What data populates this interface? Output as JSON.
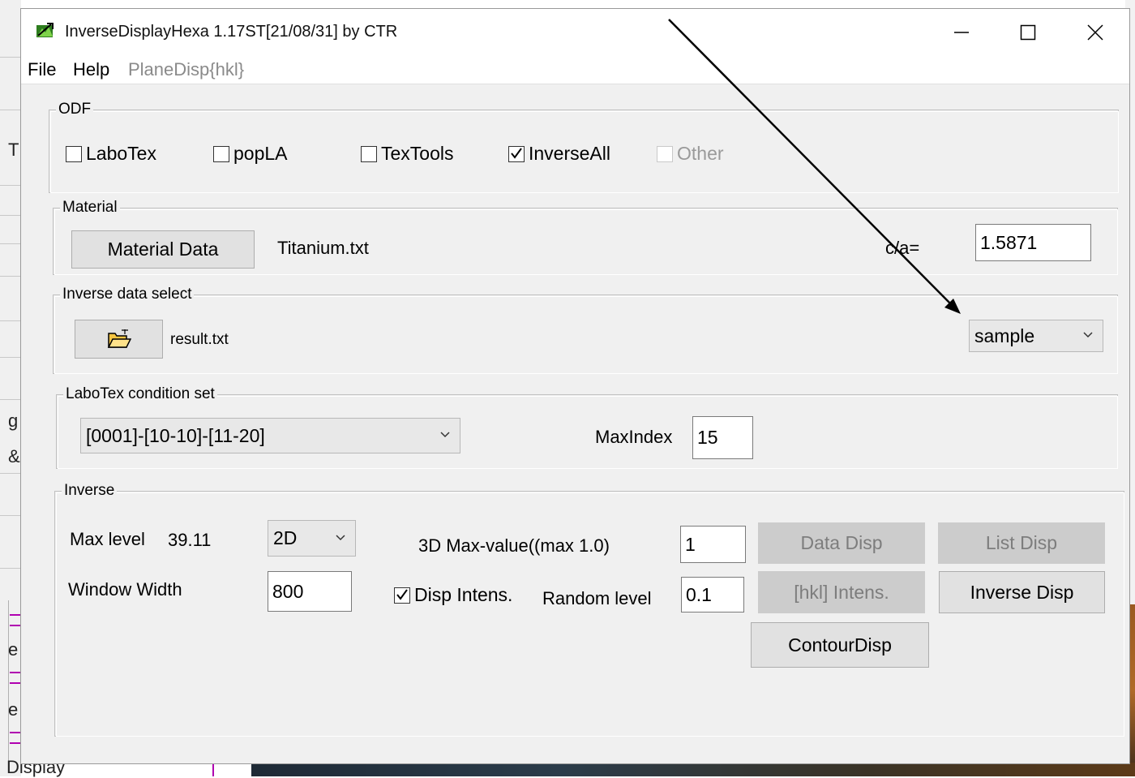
{
  "window": {
    "title": "InverseDisplayHexa 1.17ST[21/08/31] by CTR"
  },
  "menu": {
    "file": "File",
    "help": "Help",
    "plane_disp": "PlaneDisp{hkl}"
  },
  "odf": {
    "legend": "ODF",
    "options": [
      {
        "label": "LaboTex",
        "checked": false,
        "enabled": true
      },
      {
        "label": "popLA",
        "checked": false,
        "enabled": true
      },
      {
        "label": "TexTools",
        "checked": false,
        "enabled": true
      },
      {
        "label": "InverseAll",
        "checked": true,
        "enabled": true
      },
      {
        "label": "Other",
        "checked": false,
        "enabled": false
      }
    ]
  },
  "material": {
    "legend": "Material",
    "button_label": "Material Data",
    "file_name": "Titanium.txt",
    "ca_label": "c/a=",
    "ca_value": "1.5871"
  },
  "inverse_select": {
    "legend": "Inverse data select",
    "file_name": "result.txt",
    "mode_selected": "sample"
  },
  "labotex": {
    "legend": "LaboTex condition set",
    "condition_selected": "[0001]-[10-10]-[11-20]",
    "maxindex_label": "MaxIndex",
    "maxindex_value": "15"
  },
  "inverse": {
    "legend": "Inverse",
    "max_level_label": "Max level",
    "max_level_value": "39.11",
    "dim_selected": "2D",
    "window_width_label": "Window Width",
    "window_width_value": "800",
    "max_value_label": "3D Max-value((max 1.0)",
    "max_value_value": "1",
    "disp_intens_label": "Disp Intens.",
    "disp_intens_checked": true,
    "random_level_label": "Random level",
    "random_level_value": "0.1",
    "data_disp_label": "Data Disp",
    "list_disp_label": "List Disp",
    "hkl_intens_label": "[hkl] Intens.",
    "inverse_disp_label": "Inverse Disp",
    "contour_disp_label": "ContourDisp"
  },
  "background": {
    "left_glyphs": [
      "T",
      "g",
      "&",
      "e",
      "e"
    ],
    "bottom_text": "Display"
  },
  "colors": {
    "window_bg": "#f0f0f0",
    "disabled_button": "#cccccc",
    "annotation_arrow": "#000000"
  }
}
